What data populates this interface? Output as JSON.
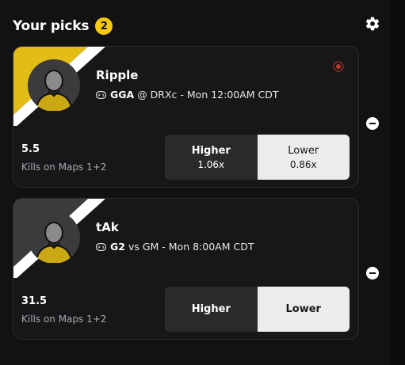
{
  "header": {
    "title": "Your picks",
    "count": "2"
  },
  "picks": [
    {
      "player": "Ripple",
      "team": "GGA",
      "matchup": "@ DRXc - Mon 12:00AM CDT",
      "line": "5.5",
      "stat": "Kills on Maps 1+2",
      "higher": {
        "label": "Higher",
        "multiplier": "1.06x"
      },
      "lower": {
        "label": "Lower",
        "multiplier": "0.86x"
      },
      "selected": "lower"
    },
    {
      "player": "tAk",
      "team": "G2",
      "matchup": "vs GM - Mon 8:00AM CDT",
      "line": "31.5",
      "stat": "Kills on Maps 1+2",
      "higher": {
        "label": "Higher"
      },
      "lower": {
        "label": "Lower"
      },
      "selected": "lower"
    }
  ],
  "colors": {
    "accent": "#f6c90e",
    "live": "#c0392b",
    "selected": "#ececee"
  }
}
